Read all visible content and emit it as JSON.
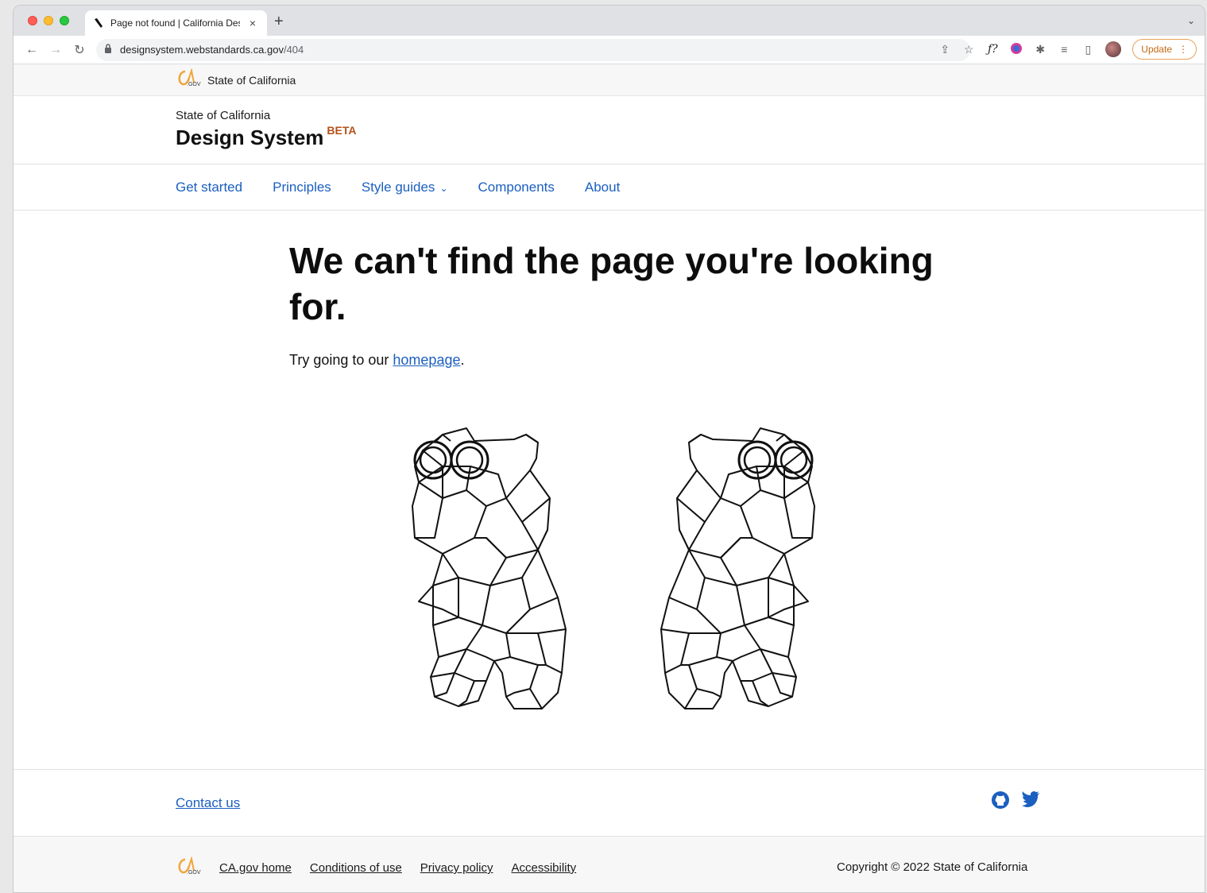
{
  "browser": {
    "tab_title": "Page not found | California Des",
    "url_host": "designsystem.webstandards.ca.gov",
    "url_path": "/404",
    "update_label": "Update"
  },
  "utility": {
    "label": "State of California"
  },
  "header": {
    "kicker": "State of California",
    "title": "Design System",
    "badge": "BETA"
  },
  "nav": {
    "items": [
      {
        "label": "Get started"
      },
      {
        "label": "Principles"
      },
      {
        "label": "Style guides"
      },
      {
        "label": "Components"
      },
      {
        "label": "About"
      }
    ]
  },
  "main": {
    "headline": "We can't find the page you're looking for.",
    "try_prefix": "Try going to our ",
    "homepage_link": "homepage",
    "try_suffix": "."
  },
  "footer": {
    "contact": "Contact us",
    "links": [
      "CA.gov home",
      "Conditions of use",
      "Privacy policy",
      "Accessibility"
    ],
    "copyright": "Copyright © 2022 State of California"
  },
  "colors": {
    "link": "#1b5fbf",
    "beta": "#b4521b",
    "update": "#c46a12"
  }
}
